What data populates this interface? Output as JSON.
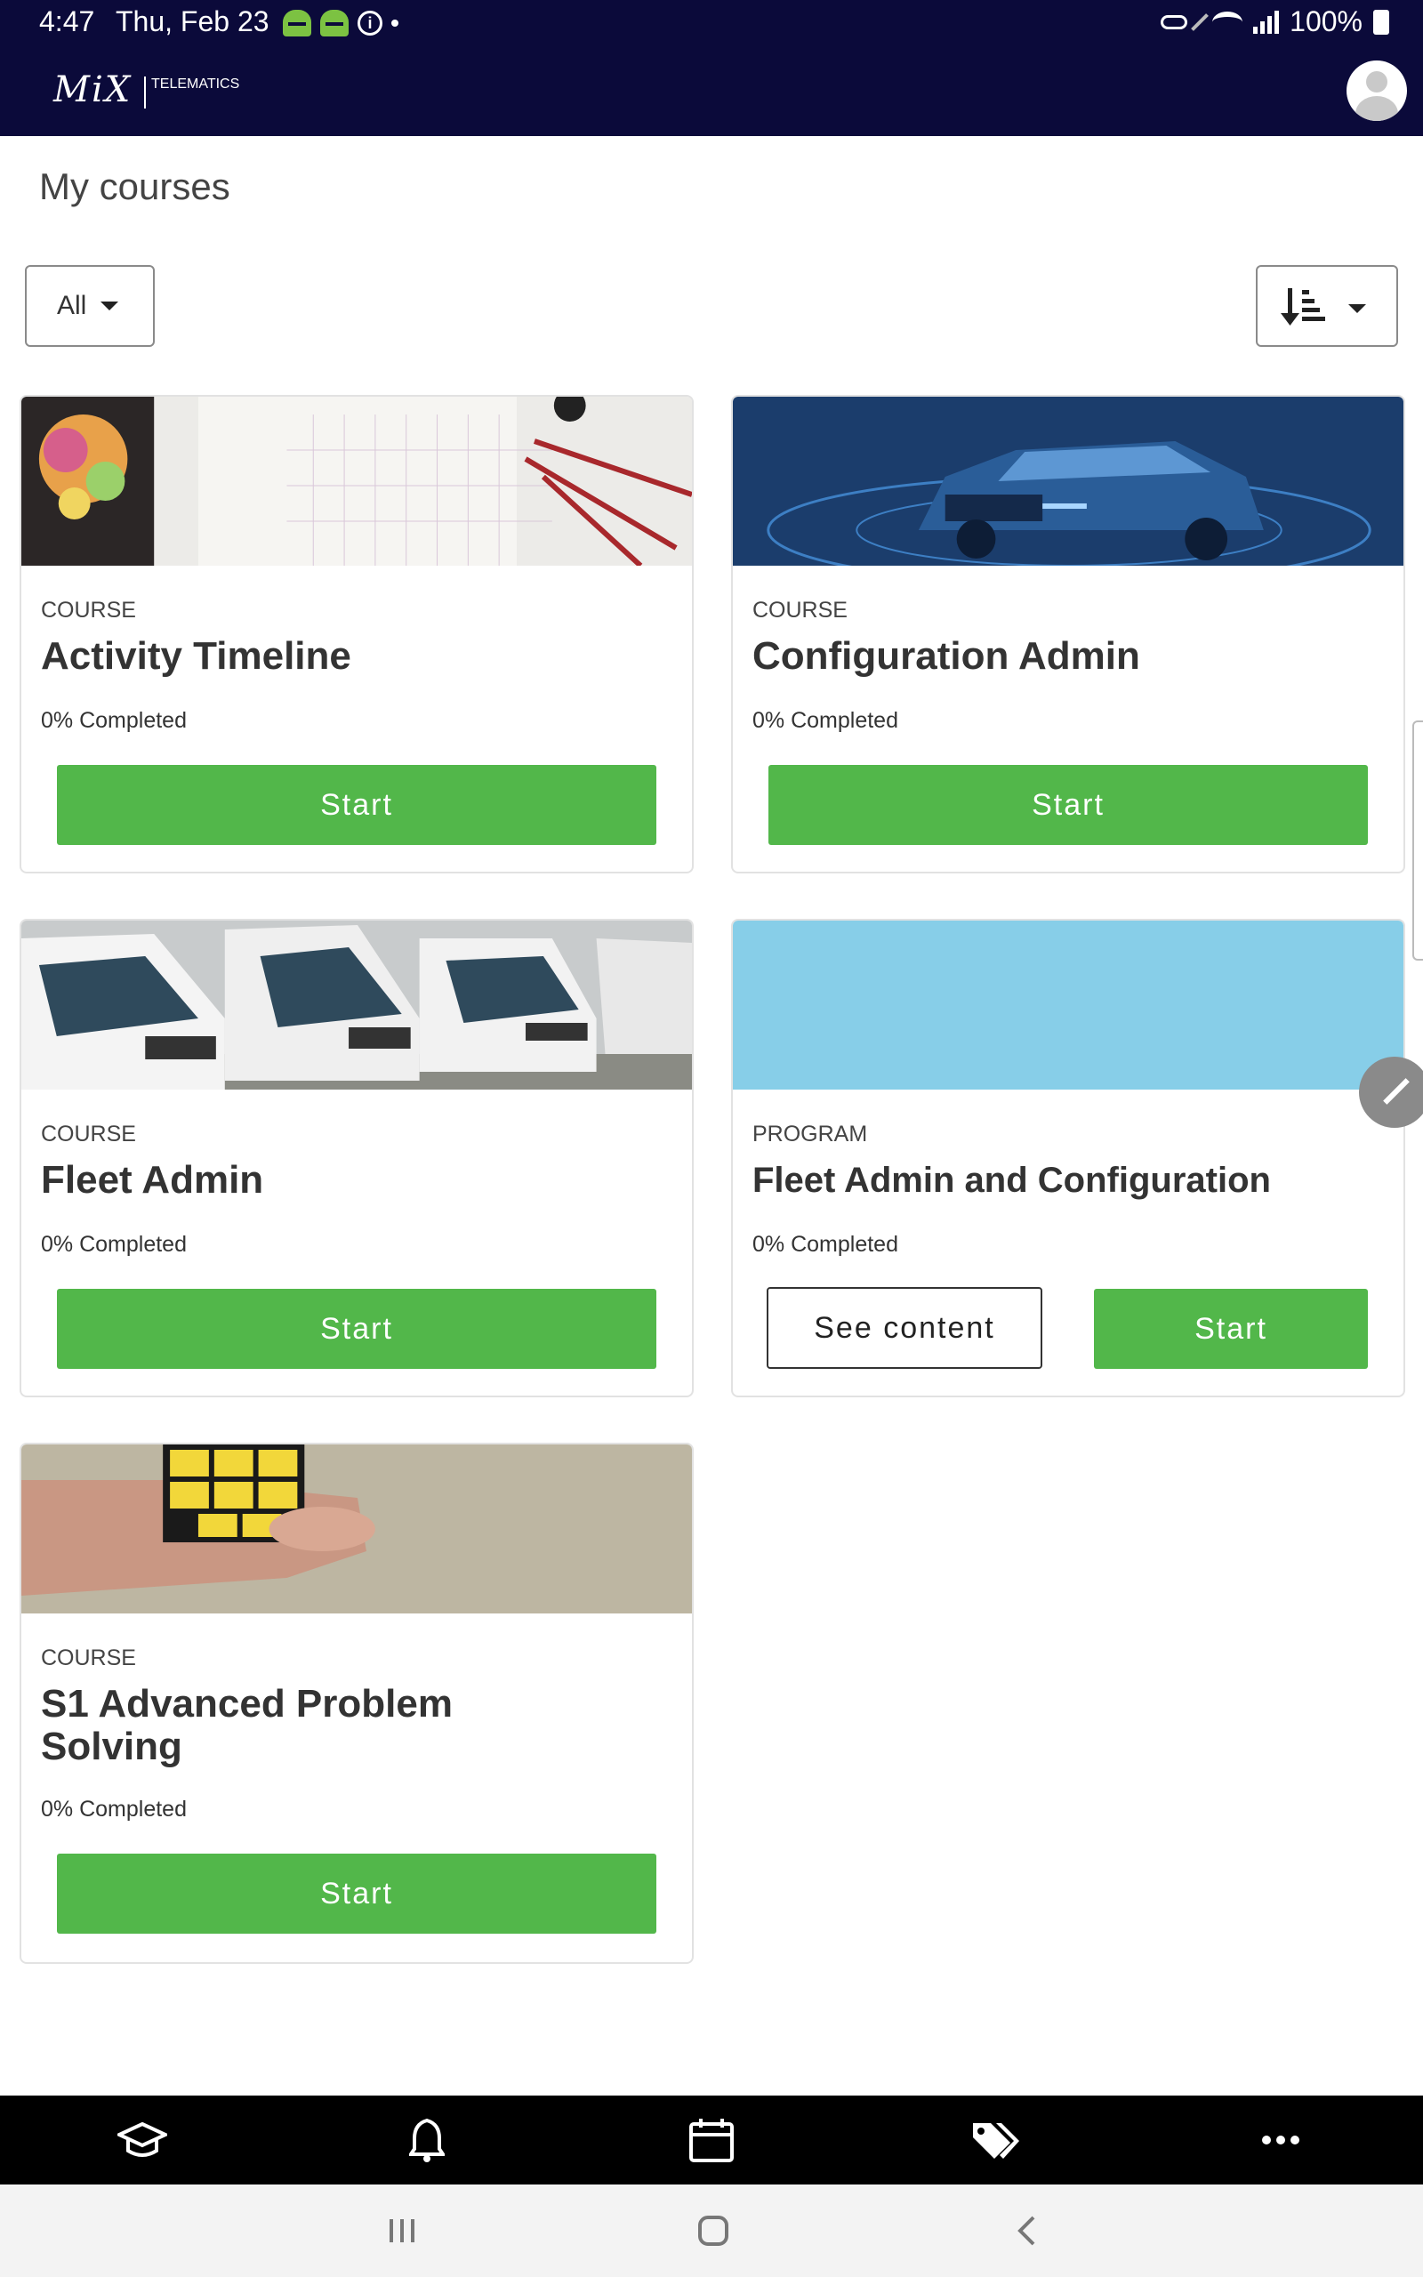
{
  "status_bar": {
    "time": "4:47",
    "date": "Thu, Feb 23",
    "battery": "100%"
  },
  "header": {
    "brand": "MiX",
    "brand_sub": "TELEMATICS"
  },
  "page": {
    "title": "My courses"
  },
  "filters": {
    "type_filter": "All"
  },
  "colors": {
    "header_bg": "#0b0a3a",
    "accent_green": "#52b74a",
    "program_image": "#87cee8"
  },
  "cards": [
    {
      "type": "COURSE",
      "title": "Activity Timeline",
      "progress": "0% Completed",
      "start_label": "Start"
    },
    {
      "type": "COURSE",
      "title": "Configuration Admin",
      "progress": "0% Completed",
      "start_label": "Start"
    },
    {
      "type": "COURSE",
      "title": "Fleet Admin",
      "progress": "0% Completed",
      "start_label": "Start"
    },
    {
      "type": "PROGRAM",
      "title": "Fleet Admin and Configuration",
      "progress": "0% Completed",
      "see_content_label": "See content",
      "start_label": "Start"
    },
    {
      "type": "COURSE",
      "title": "S1 Advanced Problem Solving",
      "progress": "0% Completed",
      "start_label": "Start"
    }
  ],
  "bottom_nav": [
    {
      "icon": "graduation-cap-icon"
    },
    {
      "icon": "bell-icon"
    },
    {
      "icon": "calendar-icon"
    },
    {
      "icon": "tags-icon"
    },
    {
      "icon": "more-icon"
    }
  ]
}
